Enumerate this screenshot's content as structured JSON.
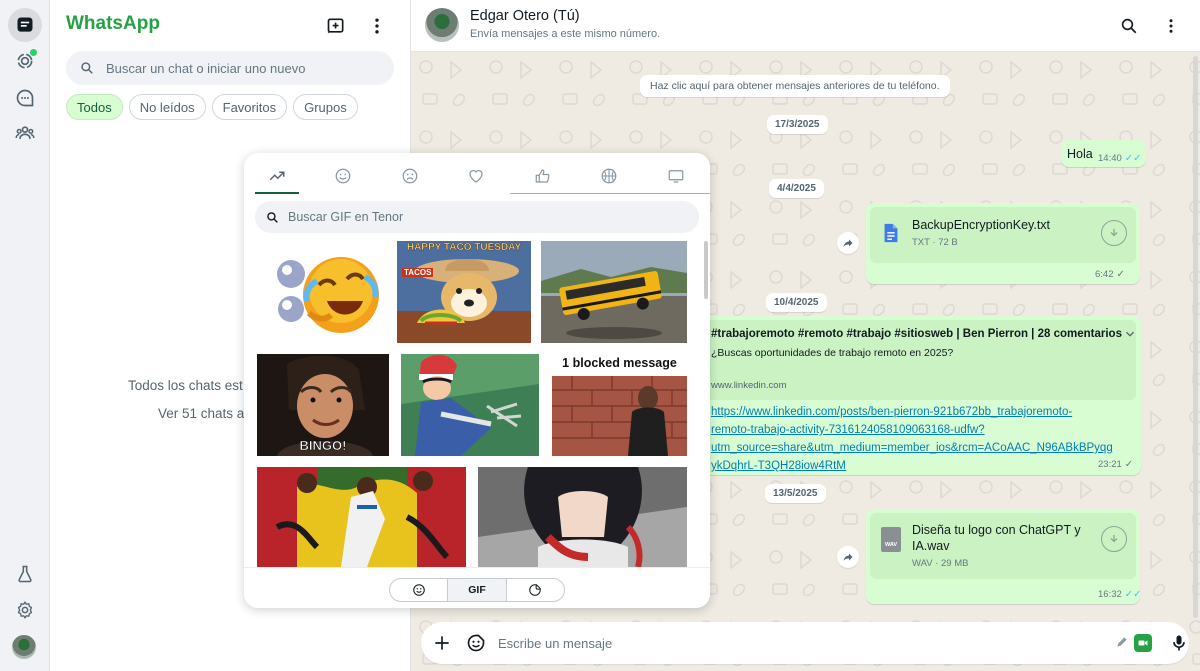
{
  "app": {
    "name": "WhatsApp",
    "colors": {
      "brand": "#25a244",
      "bubble_out": "#d9fdd3",
      "chat_bg": "#efeae2",
      "link": "#027eb5",
      "read_tick": "#53bdeb"
    }
  },
  "rail": {
    "items": [
      {
        "icon": "chats-icon",
        "active": true
      },
      {
        "icon": "status-icon",
        "badge": true
      },
      {
        "icon": "channels-icon"
      },
      {
        "icon": "communities-icon"
      }
    ],
    "bottom": [
      {
        "icon": "flask-icon"
      },
      {
        "icon": "settings-icon"
      },
      {
        "icon": "profile-avatar"
      }
    ]
  },
  "chat_list": {
    "search_placeholder": "Buscar un chat o iniciar uno nuevo",
    "filters": [
      {
        "label": "Todos",
        "active": true
      },
      {
        "label": "No leídos"
      },
      {
        "label": "Favoritos"
      },
      {
        "label": "Grupos"
      }
    ],
    "empty_line1": "Todos los chats est",
    "empty_line2": "Ver 51 chats a"
  },
  "conversation": {
    "contact_name": "Edgar Otero (Tú)",
    "contact_subtitle": "Envía mensajes a este mismo número.",
    "load_older": "Haz clic aquí para obtener mensajes anteriores de tu teléfono.",
    "messages": [
      {
        "date": "17/3/2025",
        "text": "Hola",
        "time": "14:40",
        "status": "read"
      },
      {
        "date": "4/4/2025",
        "file_name": "BackupEncryptionKey.txt",
        "file_meta": "TXT · 72 B",
        "time": "6:42",
        "status": "delivered"
      },
      {
        "date": "10/4/2025",
        "link_title": "#trabajoremoto #remoto #trabajo #sitiosweb | Ben Pierron | 28 comentarios",
        "link_desc": "¿Buscas oportunidades de trabajo remoto en 2025?",
        "link_domain": "www.linkedin.com",
        "url_lines": [
          "https://www.linkedin.com/posts/ben-pierron-921b672bb_trabajoremoto-",
          "remoto-trabajo-activity-7316124058109063168-udfw?",
          "utm_source=share&utm_medium=member_ios&rcm=ACoAAC_N96ABkBPyqg",
          "ykDqhrL-T3QH28iow4RtM"
        ],
        "time": "23:21",
        "status": "delivered"
      },
      {
        "date": "13/5/2025",
        "file_name_lines": [
          "Diseña tu logo con ChatGPT y",
          "IA.wav"
        ],
        "file_meta": "WAV · 29 MB",
        "file_badge": "WAV",
        "time": "16:32",
        "status": "read"
      }
    ],
    "composer_placeholder": "Escribe un mensaje"
  },
  "gif_picker": {
    "categories": [
      "trending-icon",
      "smile-icon",
      "sad-icon",
      "heart-icon",
      "thumbs-up-icon",
      "sports-icon",
      "tv-icon"
    ],
    "search_placeholder": "Buscar GIF en Tenor",
    "gifs": [
      {
        "name": "crying-laughing-emoji-gif"
      },
      {
        "name": "taco-tuesday-gif",
        "caption": "HAPPY TACO TUESDAY",
        "sign": "TACOS"
      },
      {
        "name": "school-bus-jump-gif"
      },
      {
        "name": "bingo-gif",
        "caption": "BINGO!"
      },
      {
        "name": "anime-fork-gif"
      },
      {
        "name": "blocked-message-gif",
        "caption": "1 blocked message"
      },
      {
        "name": "football-fans-gif"
      },
      {
        "name": "anime-girl-gif"
      }
    ],
    "bottom_tabs": [
      {
        "icon": "emoji-icon"
      },
      {
        "label": "GIF",
        "active": true
      },
      {
        "icon": "sticker-icon"
      }
    ]
  }
}
